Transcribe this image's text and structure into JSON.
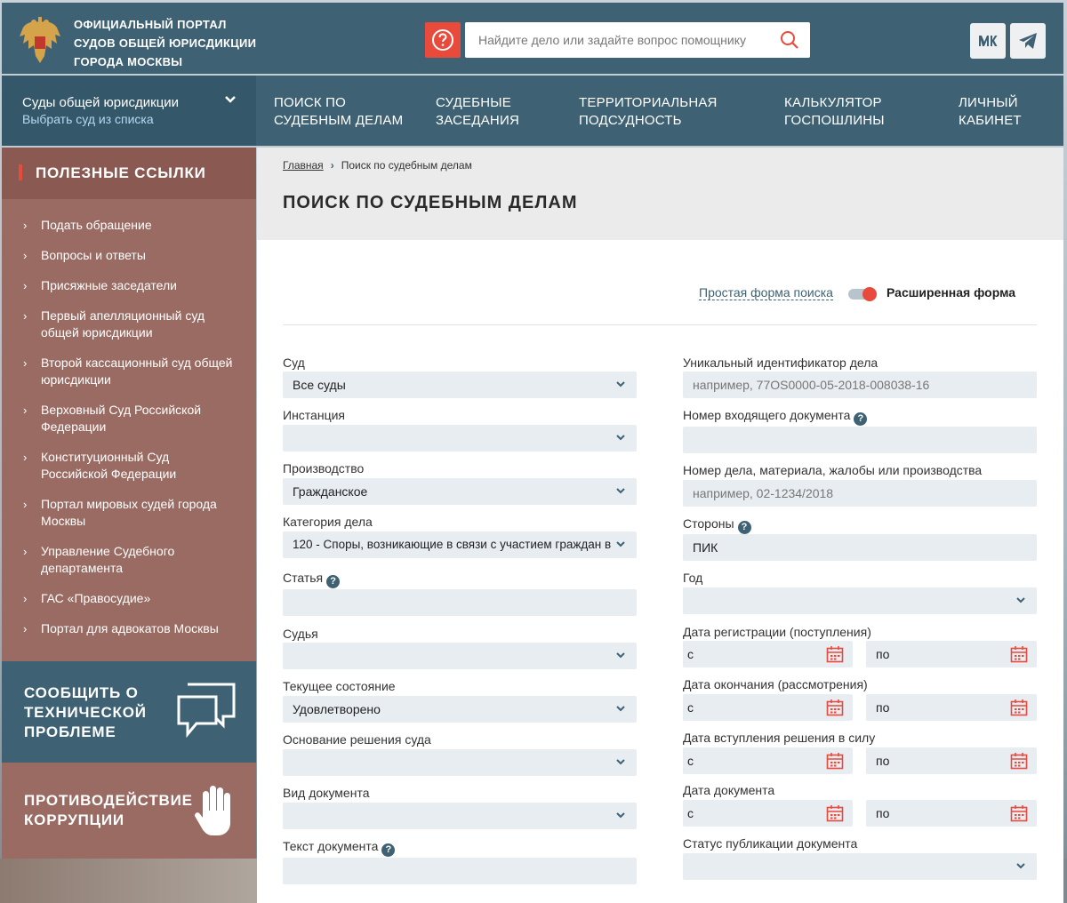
{
  "header": {
    "logo_lines": [
      "ОФИЦИАЛЬНЫЙ ПОРТАЛ",
      "СУДОВ ОБЩЕЙ ЮРИСДИКЦИИ",
      "ГОРОДА МОСКВЫ"
    ],
    "search_placeholder": "Найдите дело или задайте вопрос помощнику",
    "social": [
      "vk-icon",
      "telegram-icon"
    ]
  },
  "nav": {
    "court_title": "Суды общей юрисдикции",
    "court_link": "Выбрать суд из списка",
    "items": [
      [
        "ПОИСК ПО",
        "СУДЕБНЫМ ДЕЛАМ"
      ],
      [
        "СУДЕБНЫЕ",
        "ЗАСЕДАНИЯ"
      ],
      [
        "ТЕРРИТОРИАЛЬНАЯ",
        "ПОДСУДНОСТЬ"
      ],
      [
        "КАЛЬКУЛЯТОР",
        "ГОСПОШЛИНЫ"
      ],
      [
        "ЛИЧНЫЙ",
        "КАБИНЕТ"
      ]
    ]
  },
  "sidebar": {
    "title": "ПОЛЕЗНЫЕ ССЫЛКИ",
    "links": [
      "Подать обращение",
      "Вопросы и ответы",
      "Присяжные заседатели",
      "Первый апелляционный суд общей юрисдикции",
      "Второй кассационный суд общей юрисдикции",
      "Верховный Суд Российской Федерации",
      "Конституционный Суд Российской Федерации",
      "Портал мировых судей города Москвы",
      "Управление Судебного департамента",
      "ГАС «Правосудие»",
      "Портал для адвокатов Москвы"
    ],
    "tech_lines": [
      "СООБЩИТЬ О",
      "ТЕХНИЧЕСКОЙ",
      "ПРОБЛЕМЕ"
    ],
    "corr_lines": [
      "ПРОТИВОДЕЙСТВИЕ",
      "КОРРУПЦИИ"
    ]
  },
  "breadcrumb": {
    "home": "Главная",
    "current": "Поиск по судебным делам"
  },
  "page_title": "ПОИСК ПО СУДЕБНЫМ ДЕЛАМ",
  "mode": {
    "simple": "Простая форма поиска",
    "advanced": "Расширенная форма",
    "advanced_on": true
  },
  "form": {
    "court": {
      "label": "Суд",
      "value": "Все суды"
    },
    "instance": {
      "label": "Инстанция",
      "value": ""
    },
    "proceeding": {
      "label": "Производство",
      "value": "Гражданское"
    },
    "category": {
      "label": "Категория дела",
      "value": "120 - Споры, возникающие в связи с участием граждан в"
    },
    "article": {
      "label": "Статья",
      "value": ""
    },
    "judge": {
      "label": "Судья",
      "value": ""
    },
    "state": {
      "label": "Текущее состояние",
      "value": "Удовлетворено"
    },
    "basis": {
      "label": "Основание решения суда",
      "value": ""
    },
    "doc_type": {
      "label": "Вид документа",
      "value": ""
    },
    "doc_text": {
      "label": "Текст документа",
      "value": ""
    },
    "uid": {
      "label": "Уникальный идентификатор дела",
      "placeholder": "например, 77OS0000-05-2018-008038-16"
    },
    "incoming": {
      "label": "Номер входящего документа",
      "value": ""
    },
    "case_no": {
      "label": "Номер дела, материала, жалобы или производства",
      "placeholder": "например, 02-1234/2018"
    },
    "parties": {
      "label": "Стороны",
      "value": "ПИК"
    },
    "year": {
      "label": "Год",
      "value": ""
    },
    "date_reg": {
      "label": "Дата регистрации (поступления)",
      "from": "с",
      "to": "по"
    },
    "date_end": {
      "label": "Дата окончания (рассмотрения)",
      "from": "с",
      "to": "по"
    },
    "date_force": {
      "label": "Дата вступления решения в силу",
      "from": "с",
      "to": "по"
    },
    "date_doc": {
      "label": "Дата документа",
      "from": "с",
      "to": "по"
    },
    "pub_status": {
      "label": "Статус публикации документа",
      "value": ""
    }
  },
  "colors": {
    "primary": "#3e6274",
    "accent": "#e84a3c",
    "sidebar": "#9a6b62",
    "field": "#e8edf2"
  }
}
